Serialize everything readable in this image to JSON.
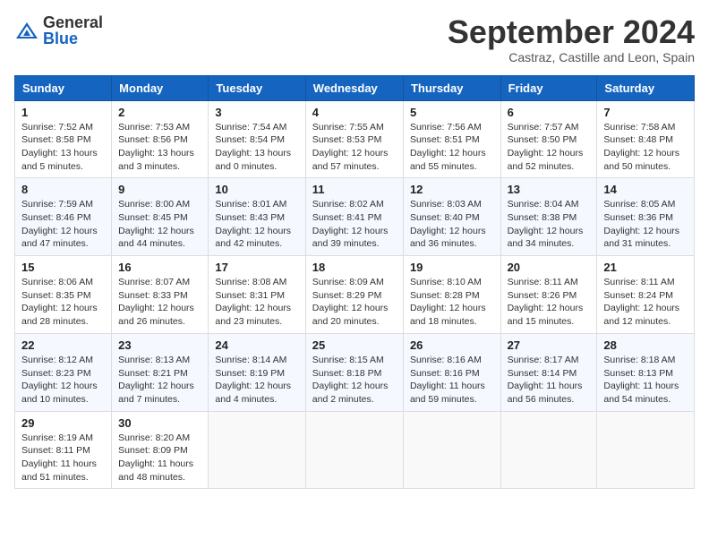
{
  "logo": {
    "general": "General",
    "blue": "Blue"
  },
  "header": {
    "month": "September 2024",
    "location": "Castraz, Castille and Leon, Spain"
  },
  "days": [
    "Sunday",
    "Monday",
    "Tuesday",
    "Wednesday",
    "Thursday",
    "Friday",
    "Saturday"
  ],
  "weeks": [
    [
      {
        "day": "1",
        "sunrise": "Sunrise: 7:52 AM",
        "sunset": "Sunset: 8:58 PM",
        "daylight": "Daylight: 13 hours and 5 minutes."
      },
      {
        "day": "2",
        "sunrise": "Sunrise: 7:53 AM",
        "sunset": "Sunset: 8:56 PM",
        "daylight": "Daylight: 13 hours and 3 minutes."
      },
      {
        "day": "3",
        "sunrise": "Sunrise: 7:54 AM",
        "sunset": "Sunset: 8:54 PM",
        "daylight": "Daylight: 13 hours and 0 minutes."
      },
      {
        "day": "4",
        "sunrise": "Sunrise: 7:55 AM",
        "sunset": "Sunset: 8:53 PM",
        "daylight": "Daylight: 12 hours and 57 minutes."
      },
      {
        "day": "5",
        "sunrise": "Sunrise: 7:56 AM",
        "sunset": "Sunset: 8:51 PM",
        "daylight": "Daylight: 12 hours and 55 minutes."
      },
      {
        "day": "6",
        "sunrise": "Sunrise: 7:57 AM",
        "sunset": "Sunset: 8:50 PM",
        "daylight": "Daylight: 12 hours and 52 minutes."
      },
      {
        "day": "7",
        "sunrise": "Sunrise: 7:58 AM",
        "sunset": "Sunset: 8:48 PM",
        "daylight": "Daylight: 12 hours and 50 minutes."
      }
    ],
    [
      {
        "day": "8",
        "sunrise": "Sunrise: 7:59 AM",
        "sunset": "Sunset: 8:46 PM",
        "daylight": "Daylight: 12 hours and 47 minutes."
      },
      {
        "day": "9",
        "sunrise": "Sunrise: 8:00 AM",
        "sunset": "Sunset: 8:45 PM",
        "daylight": "Daylight: 12 hours and 44 minutes."
      },
      {
        "day": "10",
        "sunrise": "Sunrise: 8:01 AM",
        "sunset": "Sunset: 8:43 PM",
        "daylight": "Daylight: 12 hours and 42 minutes."
      },
      {
        "day": "11",
        "sunrise": "Sunrise: 8:02 AM",
        "sunset": "Sunset: 8:41 PM",
        "daylight": "Daylight: 12 hours and 39 minutes."
      },
      {
        "day": "12",
        "sunrise": "Sunrise: 8:03 AM",
        "sunset": "Sunset: 8:40 PM",
        "daylight": "Daylight: 12 hours and 36 minutes."
      },
      {
        "day": "13",
        "sunrise": "Sunrise: 8:04 AM",
        "sunset": "Sunset: 8:38 PM",
        "daylight": "Daylight: 12 hours and 34 minutes."
      },
      {
        "day": "14",
        "sunrise": "Sunrise: 8:05 AM",
        "sunset": "Sunset: 8:36 PM",
        "daylight": "Daylight: 12 hours and 31 minutes."
      }
    ],
    [
      {
        "day": "15",
        "sunrise": "Sunrise: 8:06 AM",
        "sunset": "Sunset: 8:35 PM",
        "daylight": "Daylight: 12 hours and 28 minutes."
      },
      {
        "day": "16",
        "sunrise": "Sunrise: 8:07 AM",
        "sunset": "Sunset: 8:33 PM",
        "daylight": "Daylight: 12 hours and 26 minutes."
      },
      {
        "day": "17",
        "sunrise": "Sunrise: 8:08 AM",
        "sunset": "Sunset: 8:31 PM",
        "daylight": "Daylight: 12 hours and 23 minutes."
      },
      {
        "day": "18",
        "sunrise": "Sunrise: 8:09 AM",
        "sunset": "Sunset: 8:29 PM",
        "daylight": "Daylight: 12 hours and 20 minutes."
      },
      {
        "day": "19",
        "sunrise": "Sunrise: 8:10 AM",
        "sunset": "Sunset: 8:28 PM",
        "daylight": "Daylight: 12 hours and 18 minutes."
      },
      {
        "day": "20",
        "sunrise": "Sunrise: 8:11 AM",
        "sunset": "Sunset: 8:26 PM",
        "daylight": "Daylight: 12 hours and 15 minutes."
      },
      {
        "day": "21",
        "sunrise": "Sunrise: 8:11 AM",
        "sunset": "Sunset: 8:24 PM",
        "daylight": "Daylight: 12 hours and 12 minutes."
      }
    ],
    [
      {
        "day": "22",
        "sunrise": "Sunrise: 8:12 AM",
        "sunset": "Sunset: 8:23 PM",
        "daylight": "Daylight: 12 hours and 10 minutes."
      },
      {
        "day": "23",
        "sunrise": "Sunrise: 8:13 AM",
        "sunset": "Sunset: 8:21 PM",
        "daylight": "Daylight: 12 hours and 7 minutes."
      },
      {
        "day": "24",
        "sunrise": "Sunrise: 8:14 AM",
        "sunset": "Sunset: 8:19 PM",
        "daylight": "Daylight: 12 hours and 4 minutes."
      },
      {
        "day": "25",
        "sunrise": "Sunrise: 8:15 AM",
        "sunset": "Sunset: 8:18 PM",
        "daylight": "Daylight: 12 hours and 2 minutes."
      },
      {
        "day": "26",
        "sunrise": "Sunrise: 8:16 AM",
        "sunset": "Sunset: 8:16 PM",
        "daylight": "Daylight: 11 hours and 59 minutes."
      },
      {
        "day": "27",
        "sunrise": "Sunrise: 8:17 AM",
        "sunset": "Sunset: 8:14 PM",
        "daylight": "Daylight: 11 hours and 56 minutes."
      },
      {
        "day": "28",
        "sunrise": "Sunrise: 8:18 AM",
        "sunset": "Sunset: 8:13 PM",
        "daylight": "Daylight: 11 hours and 54 minutes."
      }
    ],
    [
      {
        "day": "29",
        "sunrise": "Sunrise: 8:19 AM",
        "sunset": "Sunset: 8:11 PM",
        "daylight": "Daylight: 11 hours and 51 minutes."
      },
      {
        "day": "30",
        "sunrise": "Sunrise: 8:20 AM",
        "sunset": "Sunset: 8:09 PM",
        "daylight": "Daylight: 11 hours and 48 minutes."
      },
      null,
      null,
      null,
      null,
      null
    ]
  ]
}
